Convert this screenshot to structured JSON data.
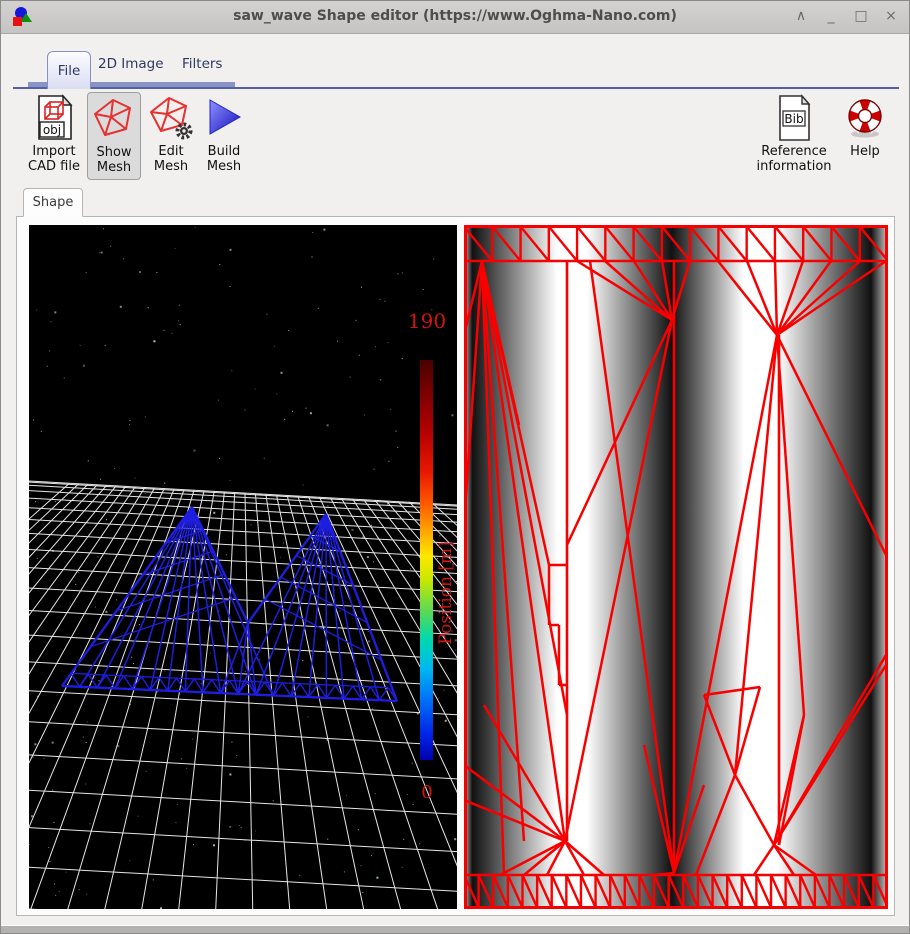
{
  "window": {
    "title": "saw_wave Shape editor (https://www.Oghma-Nano.com)",
    "controls": {
      "shade": "∧",
      "minimize": "_",
      "maximize": "□",
      "close": "×"
    }
  },
  "tabs": [
    {
      "label": "File"
    },
    {
      "label": "2D Image"
    },
    {
      "label": "Filters"
    }
  ],
  "toolbar": {
    "import_cad": {
      "line1": "Import",
      "line2": "CAD file",
      "icon_text": "obj"
    },
    "show_mesh": {
      "line1": "Show",
      "line2": "Mesh"
    },
    "edit_mesh": {
      "line1": "Edit",
      "line2": "Mesh"
    },
    "build_mesh": {
      "line1": "Build",
      "line2": "Mesh"
    },
    "reference": {
      "line1": "Reference",
      "line2": "information",
      "icon_text": "Bib"
    },
    "help": {
      "line1": "Help"
    }
  },
  "shape_tab": {
    "label": "Shape"
  },
  "viewer3d": {
    "colorbar": {
      "max": "190",
      "min": "0",
      "axis_label": "Position [m]"
    }
  },
  "colors": {
    "mesh_red": "#f80000",
    "mesh_blue": "#1e1ee0",
    "grid_white": "#e6e6e6",
    "label_red": "#d41414",
    "tab_accent": "#5560a2"
  }
}
